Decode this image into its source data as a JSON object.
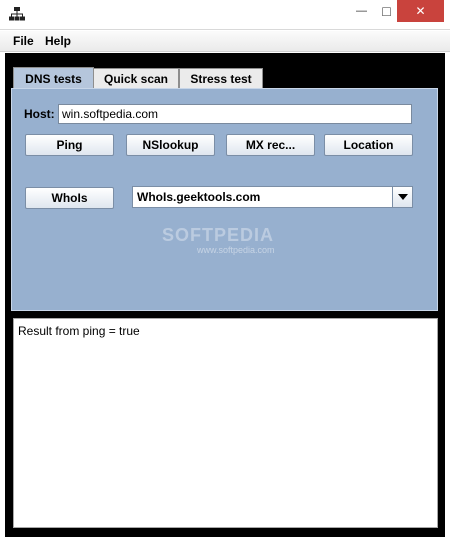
{
  "window": {
    "minimize_glyph": "—",
    "maximize_glyph": "□",
    "close_glyph": "✕",
    "icon": "network-tree-icon",
    "close_color": "#c9433d"
  },
  "menu": {
    "file": "File",
    "help": "Help"
  },
  "tabs": [
    {
      "label": "DNS tests",
      "selected": true
    },
    {
      "label": "Quick scan",
      "selected": false
    },
    {
      "label": "Stress test",
      "selected": false
    }
  ],
  "dns": {
    "host_label": "Host:",
    "host_value": "win.softpedia.com",
    "buttons": {
      "ping": "Ping",
      "nslookup": "NSlookup",
      "mx": "MX rec...",
      "location": "Location",
      "whois": "WhoIs"
    },
    "whois_server": "WhoIs.geektools.com",
    "watermark": "SOFTPEDIA",
    "watermark_url": "www.softpedia.com"
  },
  "result": {
    "text": "Result from ping = true"
  },
  "colors": {
    "panel": "#97b0cf",
    "background": "#000000",
    "selected_tab": "#b5c6dc"
  }
}
